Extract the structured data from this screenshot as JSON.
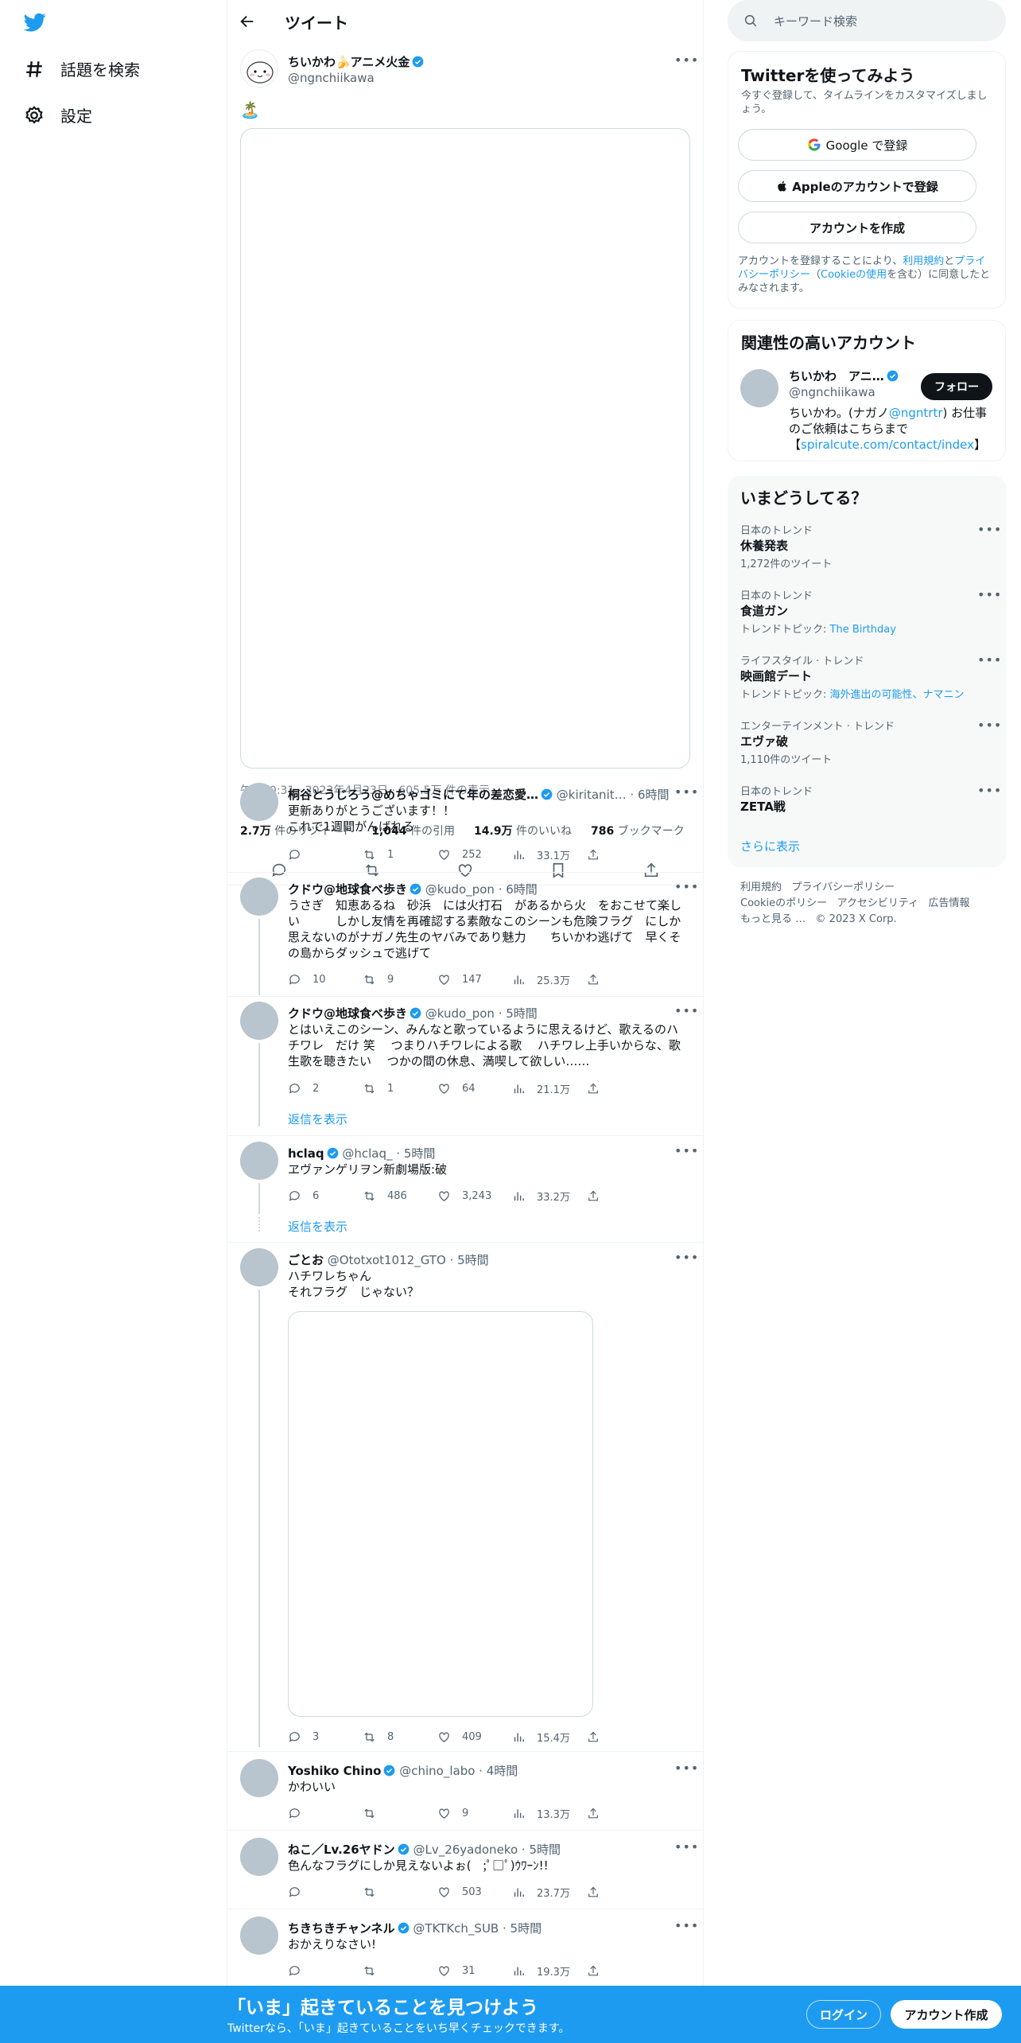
{
  "nav": {
    "explore_label": "話題を検索",
    "settings_label": "設定"
  },
  "header": {
    "title": "ツイート"
  },
  "main_tweet": {
    "name": "ちいかわ🍌アニメ火金",
    "handle": "@ngnchiikawa",
    "emoji": "🏝️",
    "meta": "午後10:31 · 2023年4月23日 · 605.5万 件の表示",
    "stats": [
      {
        "value": "2.7万",
        "label": "件のリツイート"
      },
      {
        "value": "1,044",
        "label": "件の引用"
      },
      {
        "value": "14.9万",
        "label": "件のいいね"
      },
      {
        "value": "786",
        "label": "ブックマーク"
      }
    ]
  },
  "replies": [
    {
      "name": "桐谷とうじろう@めちゃゴミにて年の差恋愛…",
      "handle": "@kiritanit…",
      "time": "· 6時間",
      "text": "更新ありがとうございます！！\nこれで1週間がんばれる",
      "reply_count": "",
      "retweet_count": "1",
      "like_count": "252",
      "view_count": "33.1万"
    },
    {
      "name": "クドウ@地球食べ歩き",
      "handle": "@kudo_pon",
      "time": "· 6時間",
      "text": "うさぎ　知恵あるね　砂浜　には火打石　があるから火　をおこせて楽しい　　　しかし友情を再確認する素敵なこのシーンも危険フラグ　にしか思えないのがナガノ先生のヤバみであり魅力　　ちいかわ逃げて　早くその島からダッシュで逃げて",
      "reply_count": "10",
      "retweet_count": "9",
      "like_count": "147",
      "view_count": "25.3万"
    },
    {
      "name": "クドウ@地球食べ歩き",
      "handle": "@kudo_pon",
      "time": "· 5時間",
      "text": "とはいえこのシーン、みんなと歌っているように思えるけど、歌えるのハチワレ　だけ 笑　 つまりハチワレによる歌　 ハチワレ上手いからな、歌　 生歌を聴きたい　 つかの間の休息、満喫して欲しい……",
      "reply_count": "2",
      "retweet_count": "1",
      "like_count": "64",
      "view_count": "21.1万",
      "show_replies": "返信を表示"
    },
    {
      "name": "hclaq",
      "handle": "@hclaq_",
      "time": "· 5時間",
      "text": "ヱヴァンゲリヲン新劇場版:破",
      "reply_count": "6",
      "retweet_count": "486",
      "like_count": "3,243",
      "view_count": "33.2万",
      "show_replies": "返信を表示"
    },
    {
      "name": "ごとお",
      "handle": "@Ototxot1012_GTO",
      "time": "· 5時間",
      "text": "ハチワレちゃん\nそれフラグ　じゃない？",
      "reply_count": "3",
      "retweet_count": "8",
      "like_count": "409",
      "view_count": "15.4万"
    },
    {
      "name": "Yoshiko Chino",
      "handle": "@chino_labo",
      "time": "· 4時間",
      "text": "かわいい",
      "reply_count": "",
      "retweet_count": "",
      "like_count": "9",
      "view_count": "13.3万"
    },
    {
      "name": "ねこ／Lv.26ヤドン",
      "handle": "@Lv_26yadoneko",
      "time": "· 5時間",
      "text": "色んなフラグにしか見えないよぉ(　;ﾟ□ﾟ)ｳﾜｰﾝ!!",
      "reply_count": "",
      "retweet_count": "",
      "like_count": "503",
      "view_count": "23.7万"
    },
    {
      "name": "ちきちきチャンネル",
      "handle": "@TKTKch_SUB",
      "time": "· 5時間",
      "text": "おかえりなさい!",
      "reply_count": "",
      "retweet_count": "",
      "like_count": "31",
      "view_count": "19.3万"
    }
  ],
  "search": {
    "placeholder": "キーワード検索"
  },
  "signup": {
    "title": "Twitterを使ってみよう",
    "subtitle": "今すぐ登録して、タイムラインをカスタマイズしましょう。",
    "google_label": "Google で登録",
    "apple_label": "Appleのアカウントで登録",
    "create_label": "アカウントを作成",
    "terms_prefix": "アカウントを登録することにより、",
    "terms_link": "利用規約",
    "terms_and": "と",
    "privacy_link": "プライバシーポリシー",
    "cookie_open": "（",
    "cookie_link": "Cookieの使用",
    "terms_suffix": "を含む）に同意したとみなされます。"
  },
  "related": {
    "title": "関連性の高いアカウント",
    "name": "ちいかわ　アニ…",
    "handle": "@ngnchiikawa",
    "follow_label": "フォロー",
    "bio_1": "ちいかわ。(ナガノ",
    "bio_link": "@ngntrtr",
    "bio_2": ") お仕事のご依頼はこちらまで",
    "bio_3a": "【",
    "bio_url": "spiralcute.com/contact/index",
    "bio_3b": "】"
  },
  "trends": {
    "title": "いまどうしてる？",
    "items": [
      {
        "category": "日本のトレンド",
        "name": "休養発表",
        "sub": "1,272件のツイート",
        "topic_label": "",
        "topic": ""
      },
      {
        "category": "日本のトレンド",
        "name": "食道ガン",
        "sub": "",
        "topic_label": "トレンドトピック: ",
        "topic": "The Birthday"
      },
      {
        "category": "ライフスタイル · トレンド",
        "name": "映画館デート",
        "sub": "",
        "topic_label": "トレンドトピック: ",
        "topic": "海外進出の可能性、ナマニン"
      },
      {
        "category": "エンターテインメント · トレンド",
        "name": "エヴァ破",
        "sub": "1,110件のツイート",
        "topic_label": "",
        "topic": ""
      },
      {
        "category": "日本のトレンド",
        "name": "ZETA戦",
        "sub": "",
        "topic_label": "",
        "topic": ""
      }
    ],
    "show_more": "さらに表示"
  },
  "footer": {
    "links": [
      "利用規約",
      "プライバシーポリシー",
      "Cookieのポリシー",
      "アクセシビリティ",
      "広告情報",
      "もっと見る …"
    ],
    "copyright": "© 2023 X Corp."
  },
  "bottom_bar": {
    "title": "「いま」起きていることを見つけよう",
    "subtitle": "Twitterなら、「いま」起きていることをいち早くチェックできます。",
    "login_label": "ログイン",
    "signup_label": "アカウント作成"
  },
  "colors": {
    "accent": "#1d9bf0",
    "bar": "#1d9bf0"
  }
}
